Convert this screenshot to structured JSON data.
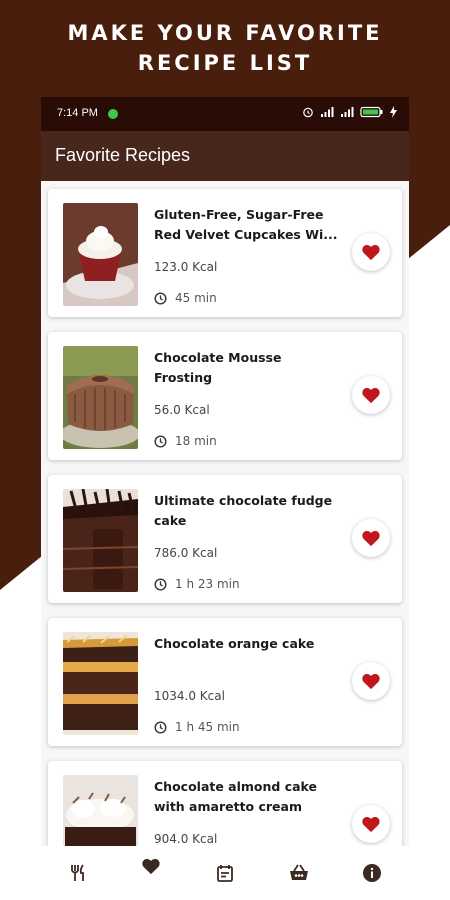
{
  "promo": {
    "line1": "MAKE YOUR FAVORITE",
    "line2": "RECIPE LIST"
  },
  "status_bar": {
    "time": "7:14 PM"
  },
  "app_bar": {
    "title": "Favorite Recipes"
  },
  "recipes": [
    {
      "title": "Gluten-Free, Sugar-Free Red Velvet Cupcakes Wi...",
      "kcal": "123.0 Kcal",
      "time": "45 min",
      "image_icon": "cupcake-photo"
    },
    {
      "title": "Chocolate Mousse Frosting",
      "kcal": "56.0 Kcal",
      "time": "18 min",
      "image_icon": "bundt-cake-photo"
    },
    {
      "title": "Ultimate chocolate fudge cake",
      "kcal": "786.0 Kcal",
      "time": "1 h 23 min",
      "image_icon": "fudge-cake-photo"
    },
    {
      "title": "Chocolate orange cake",
      "kcal": "1034.0 Kcal",
      "time": "1 h 45 min",
      "image_icon": "layer-cake-photo"
    },
    {
      "title": "Chocolate almond cake with amaretto cream",
      "kcal": "904.0 Kcal",
      "time": "",
      "image_icon": "cream-cake-photo"
    }
  ],
  "bottom_nav": [
    {
      "icon": "restaurant-icon",
      "active": false
    },
    {
      "icon": "heart-icon",
      "active": true
    },
    {
      "icon": "calendar-icon",
      "active": false
    },
    {
      "icon": "basket-icon",
      "active": false
    },
    {
      "icon": "info-icon",
      "active": false
    }
  ],
  "colors": {
    "brown_dark": "#4a1e0c",
    "app_bar": "#47261c",
    "status_bar": "#2a0c07",
    "heart_red": "#c0161e",
    "nav_icon": "#3b2a22"
  }
}
